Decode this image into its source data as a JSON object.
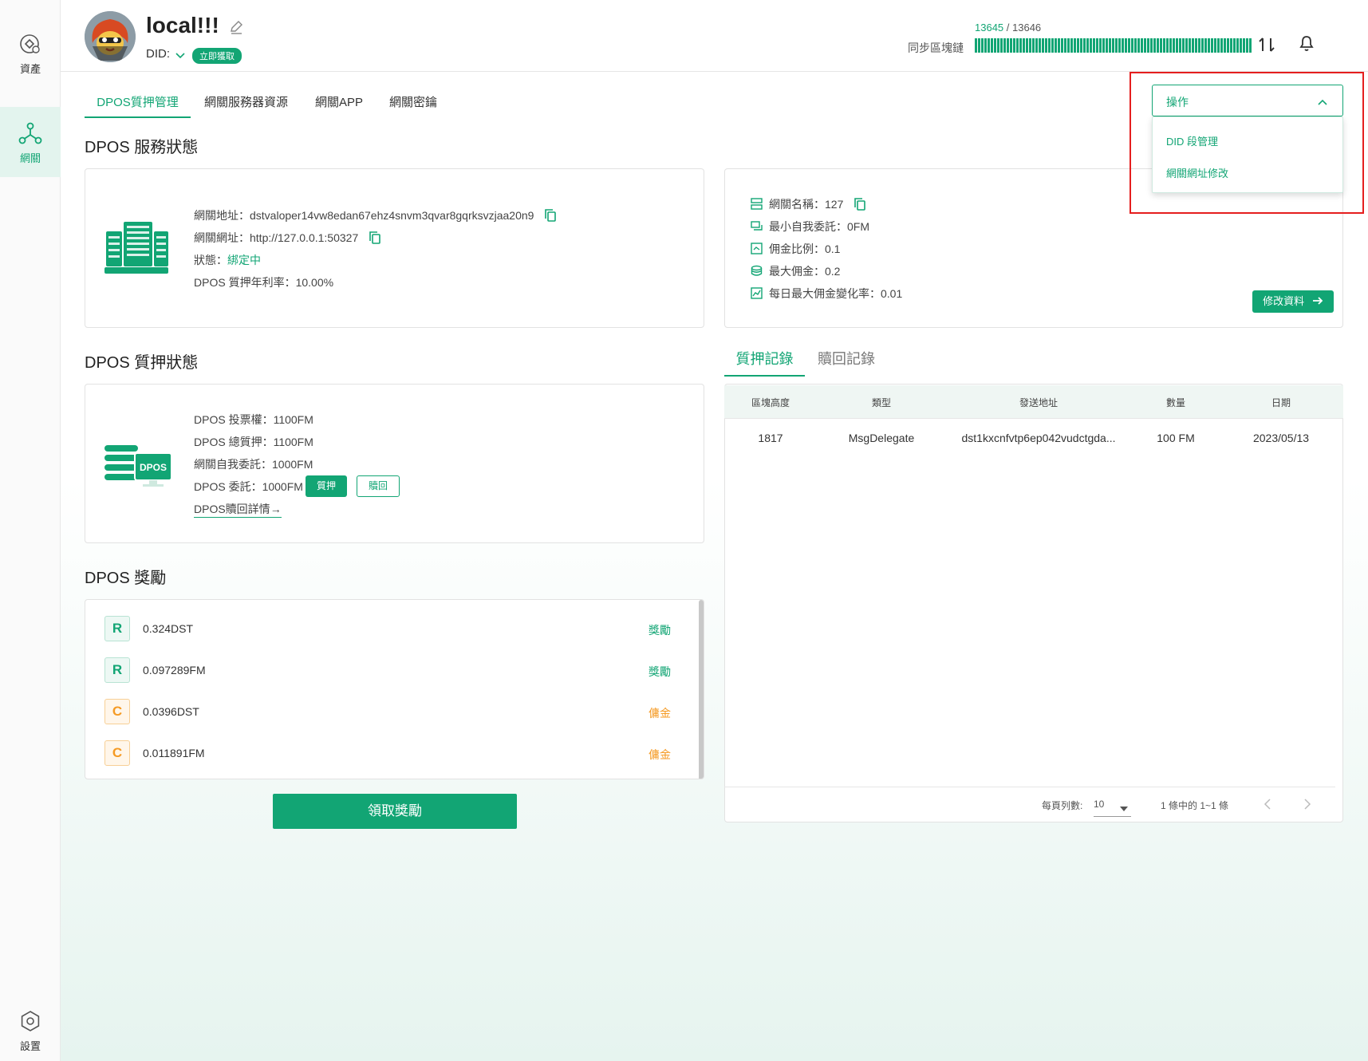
{
  "sidebar": {
    "items": [
      {
        "label": "資產",
        "icon": "asset-icon"
      },
      {
        "label": "網關",
        "icon": "gateway-icon"
      },
      {
        "label": "設置",
        "icon": "settings-icon"
      }
    ]
  },
  "header": {
    "node_name": "local!!!",
    "did_label": "DID:",
    "did_badge": "立即獲取",
    "sync_label": "同步區塊鏈",
    "sync_current": "13645",
    "sync_separator": " / ",
    "sync_total": "13646"
  },
  "tabs": [
    "DPOS質押管理",
    "網關服務器資源",
    "網關APP",
    "網關密鑰"
  ],
  "operation": {
    "label": "操作",
    "menu": [
      "DID 段管理",
      "網關網址修改"
    ]
  },
  "service_status": {
    "title": "DPOS 服務狀態",
    "address_label": "網關地址：",
    "address_value": "dstvaloper14vw8edan67ehz4snvm3qvar8gqrksvzjaa20n9",
    "url_label": "網關網址：",
    "url_value": "http://127.0.0.1:50327",
    "state_label": "狀態：",
    "state_value": "綁定中",
    "apr_label": "DPOS 質押年利率：",
    "apr_value": "10.00%"
  },
  "gateway_info": {
    "name_label": "網關名稱：",
    "name_value": "127",
    "min_self_label": "最小自我委託：",
    "min_self_value": "0FM",
    "commission_label": "佣金比例：",
    "commission_value": "0.1",
    "max_commission_label": "最大佣金：",
    "max_commission_value": "0.2",
    "max_change_label": "每日最大佣金變化率：",
    "max_change_value": "0.01",
    "edit_button": "修改資料"
  },
  "stake_status": {
    "title": "DPOS 質押狀態",
    "icon_text": "DPOS",
    "voting_label": "DPOS 投票權：",
    "voting_value": "1100FM",
    "total_label": "DPOS 總質押：",
    "total_value": "1100FM",
    "self_label": "網關自我委託：",
    "self_value": "1000FM",
    "delegate_label": "DPOS 委託：",
    "delegate_value": "1000FM",
    "stake_button": "質押",
    "redeem_button": "贖回",
    "redeem_detail_link": "DPOS贖回詳情"
  },
  "rewards": {
    "title": "DPOS 獎勵",
    "items": [
      {
        "badge": "R",
        "amount": "0.324DST",
        "type": "獎勵"
      },
      {
        "badge": "R",
        "amount": "0.097289FM",
        "type": "獎勵"
      },
      {
        "badge": "C",
        "amount": "0.0396DST",
        "type": "傭金"
      },
      {
        "badge": "C",
        "amount": "0.011891FM",
        "type": "傭金"
      }
    ],
    "claim_button": "領取獎勵"
  },
  "records": {
    "tabs": [
      "質押記錄",
      "贖回記錄"
    ],
    "columns": [
      "區塊高度",
      "類型",
      "發送地址",
      "數量",
      "日期"
    ],
    "rows": [
      {
        "height": "1817",
        "type": "MsgDelegate",
        "sender": "dst1kxcnfvtp6ep042vudctgda...",
        "amount": "100 FM",
        "date": "2023/05/13"
      }
    ],
    "rows_per_page_label": "每頁列數:",
    "rows_per_page_value": "10",
    "range_text": "1 條中的 1~1 條"
  },
  "colors": {
    "accent": "#12a574",
    "commission": "#f59a23",
    "highlight_border": "#e51e1e"
  }
}
